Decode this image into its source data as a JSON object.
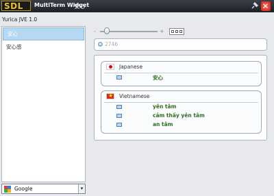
{
  "titlebar": {
    "logo": "SDL",
    "app_name": "MultiTerm Widget",
    "current_term": "- 安心"
  },
  "window_label": "Yurica JVE 1.0",
  "sidebar": {
    "items": [
      {
        "label": "安心",
        "selected": true
      },
      {
        "label": "安心感",
        "selected": false
      }
    ]
  },
  "search_provider": {
    "selected": "Google"
  },
  "zoom": {
    "minus": "-",
    "plus": "+",
    "level": 0.1
  },
  "entry": {
    "id": "2746"
  },
  "groups": [
    {
      "language": "Japanese",
      "flag": "japan-flag-icon",
      "terms": [
        "安心"
      ]
    },
    {
      "language": "Vietnamese",
      "flag": "vietnam-flag-icon",
      "terms": [
        "yên tâm",
        "cảm thấy yên tâm",
        "an tâm"
      ]
    }
  ],
  "colors": {
    "title_bg": "#2b2f36",
    "selected_bg": "#b7d8f3",
    "term_text": "#2d6e1f",
    "logo_gold": "#e8c22a"
  }
}
